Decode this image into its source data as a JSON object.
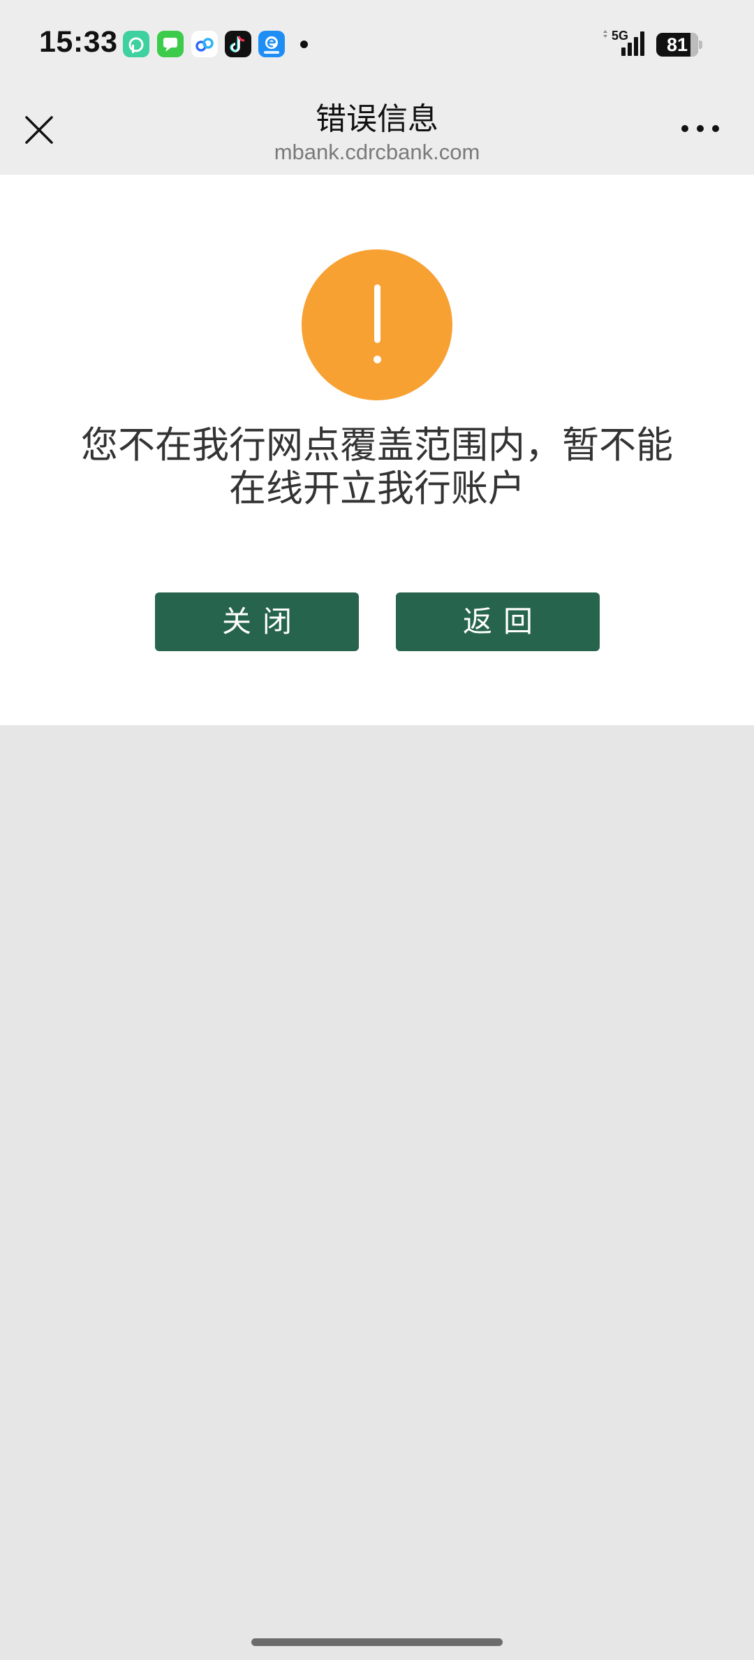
{
  "status_bar": {
    "time": "15:33",
    "network": "5G",
    "battery_level": "81",
    "battery_percent": 81,
    "notification_icons": [
      "dingtalk-icon",
      "messages-icon",
      "cloud-app-icon",
      "tiktok-icon",
      "browser-app-icon"
    ]
  },
  "nav": {
    "title": "错误信息",
    "url": "mbank.cdrcbank.com",
    "close_icon": "close-icon",
    "more_icon": "more-icon"
  },
  "dialog": {
    "icon": "warning-icon",
    "message_line1": "您不在我行网点覆盖范围内，暂不能",
    "message_line2": "在线开立我行账户",
    "close_button": "关闭",
    "back_button": "返回"
  },
  "colors": {
    "accent_button": "#27644d",
    "warning": "#f7a133",
    "page_background": "#e6e6e6",
    "header_background": "#ededed"
  }
}
